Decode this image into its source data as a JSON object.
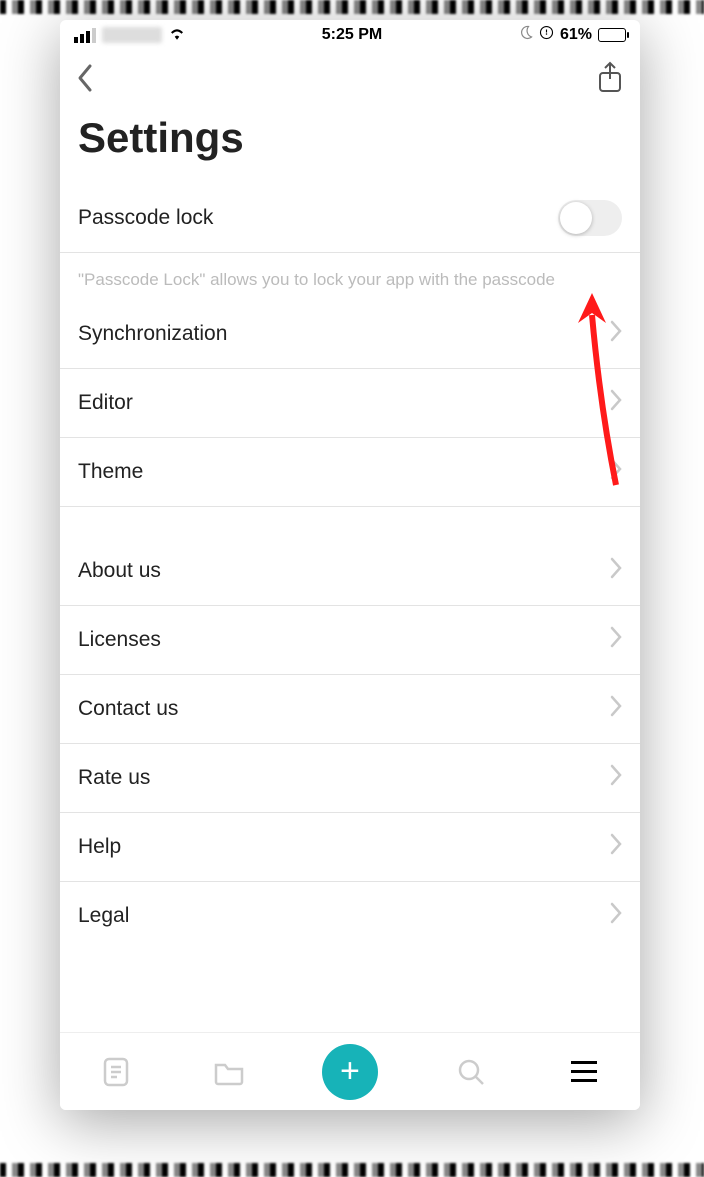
{
  "status_bar": {
    "time": "5:25 PM",
    "battery_percent": "61%"
  },
  "nav": {},
  "page_title": "Settings",
  "passcode": {
    "label": "Passcode lock",
    "enabled": false,
    "footer": "\"Passcode Lock\" allows you to lock your app with the passcode"
  },
  "group_main": {
    "items": [
      {
        "label": "Synchronization"
      },
      {
        "label": "Editor"
      },
      {
        "label": "Theme"
      }
    ]
  },
  "group_about": {
    "items": [
      {
        "label": "About us"
      },
      {
        "label": "Licenses"
      },
      {
        "label": "Contact us"
      },
      {
        "label": "Rate us"
      },
      {
        "label": "Help"
      },
      {
        "label": "Legal"
      }
    ]
  },
  "bottom_bar": {
    "add_glyph": "+"
  }
}
